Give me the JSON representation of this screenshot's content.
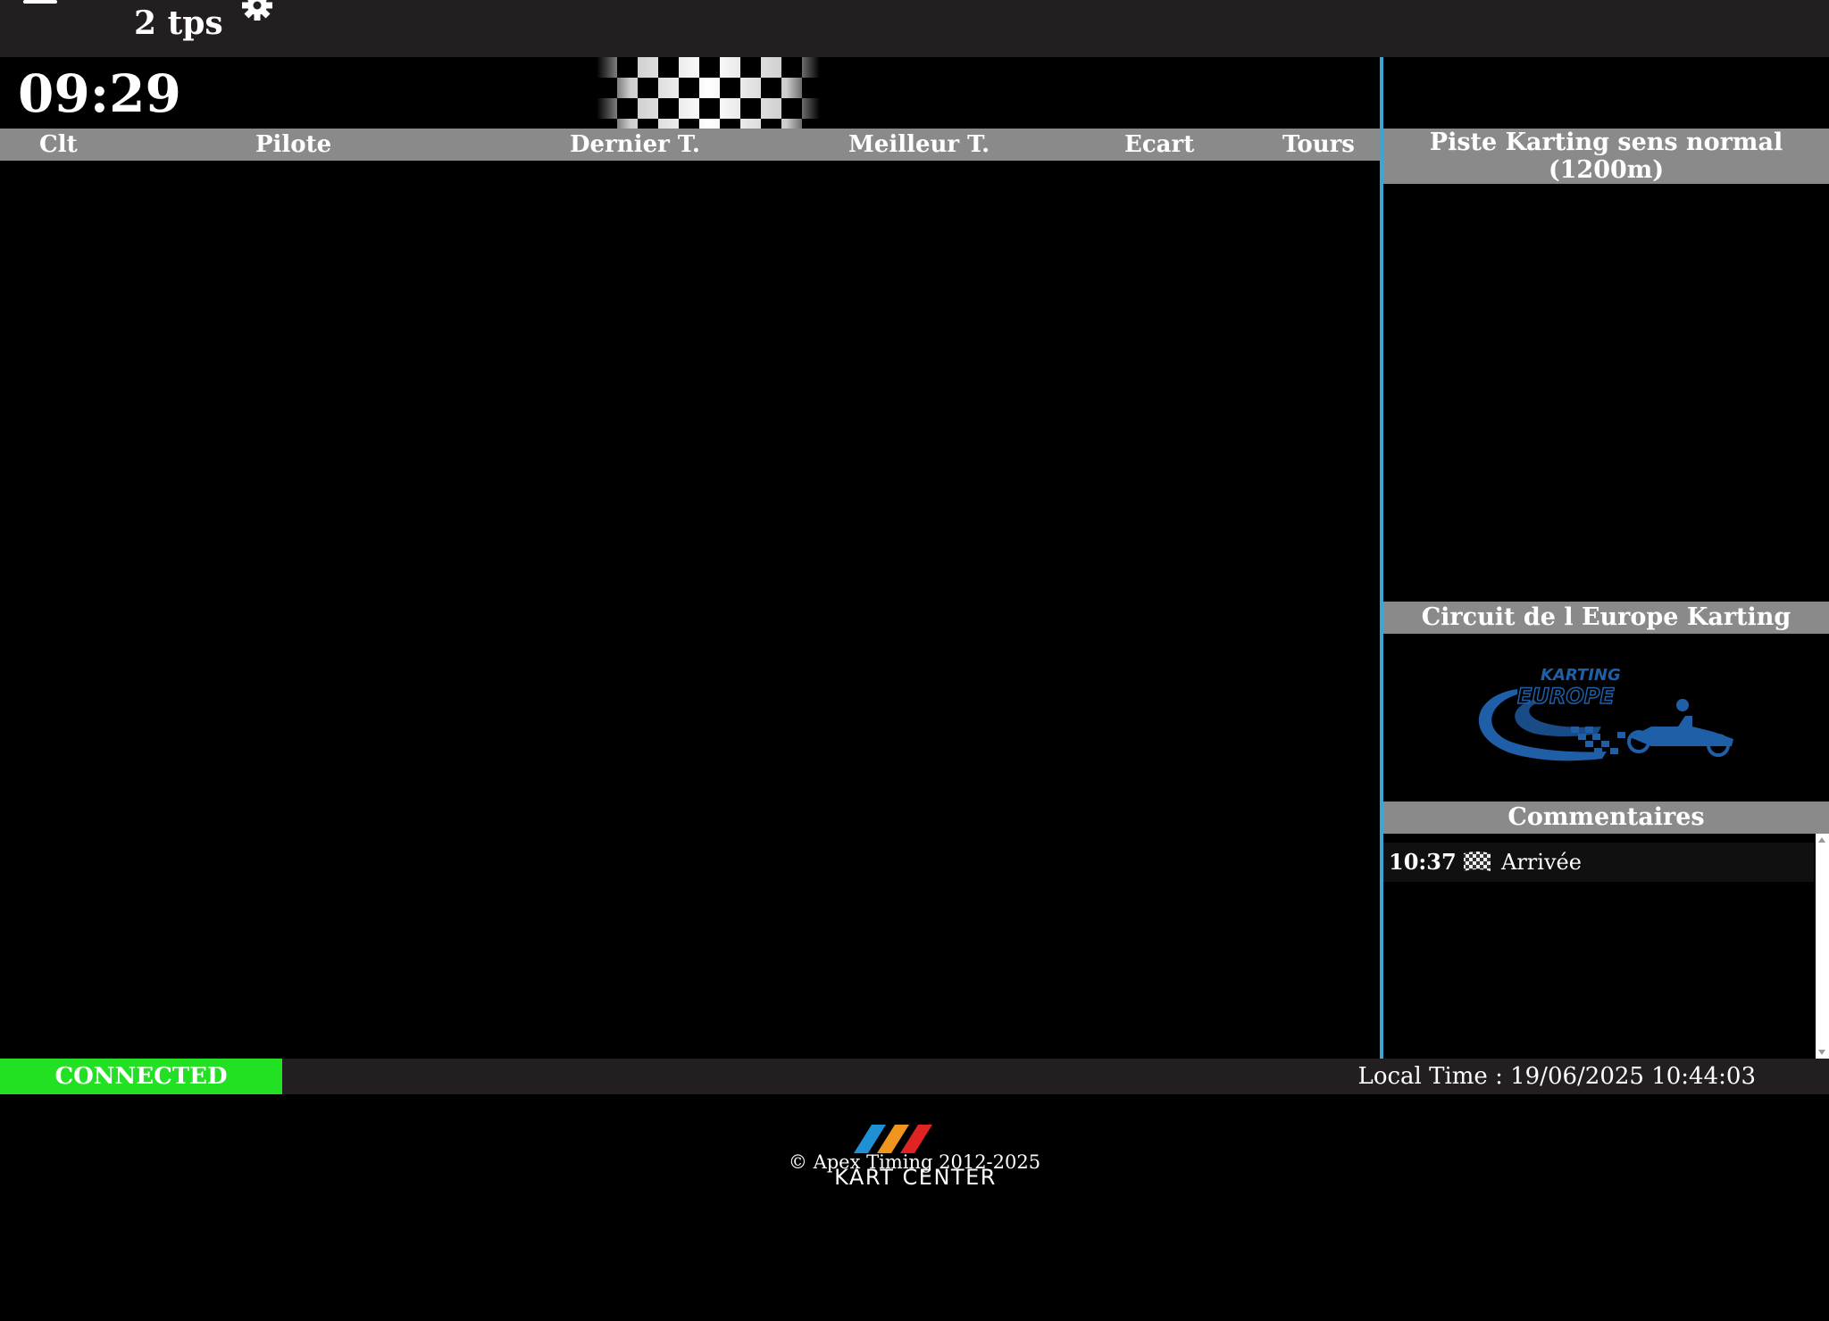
{
  "topbar": {
    "tps_label": "2 tps",
    "icons": [
      "menu-icon",
      "gear-icon"
    ]
  },
  "session": {
    "clock": "09:29",
    "flag": "checkered-flag"
  },
  "table": {
    "columns": [
      "Clt",
      "Pilote",
      "Dernier T.",
      "Meilleur T.",
      "Ecart",
      "Tours"
    ],
    "rows": []
  },
  "sidebar": {
    "track_title": "Piste Karting sens normal (1200m)",
    "circuit_title": "Circuit de l Europe Karting",
    "circuit_logo": {
      "line1": "KARTING",
      "line2": "EUROPE"
    },
    "comments_title": "Commentaires",
    "comments": [
      {
        "time": "10:37",
        "icon": "checkered-flag-icon",
        "text": "Arrivée"
      }
    ]
  },
  "status": {
    "connection": "CONNECTED",
    "local_time": "Local Time : 19/06/2025 10:44:03"
  },
  "footer": {
    "copyright": "© Apex Timing 2012-2025",
    "brand": "KART CENTER"
  },
  "colors": {
    "header_bg": "#231f20",
    "column_header_bg": "#8a8a8a",
    "divider": "#3aa6d8",
    "connected": "#22e022",
    "logo_blue": "#1f5fa8"
  }
}
